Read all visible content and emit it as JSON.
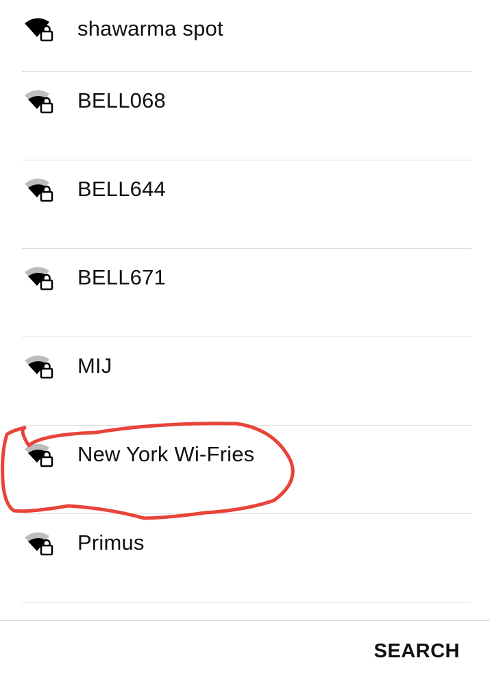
{
  "networks": [
    {
      "name": "shawarma spot",
      "signal": "full",
      "secured": true
    },
    {
      "name": "BELL068",
      "signal": "partial",
      "secured": true
    },
    {
      "name": "BELL644",
      "signal": "partial",
      "secured": true
    },
    {
      "name": "BELL671",
      "signal": "partial",
      "secured": true
    },
    {
      "name": "MIJ",
      "signal": "partial",
      "secured": true
    },
    {
      "name": "New York Wi-Fries",
      "signal": "partial",
      "secured": true
    },
    {
      "name": "Primus",
      "signal": "partial",
      "secured": true
    }
  ],
  "footer": {
    "search_label": "SEARCH"
  },
  "colors": {
    "signal_strong": "#000000",
    "signal_weak": "#bdbdbd",
    "annotation": "#e8443a"
  },
  "icons": {
    "network": "wifi-locked-icon"
  }
}
